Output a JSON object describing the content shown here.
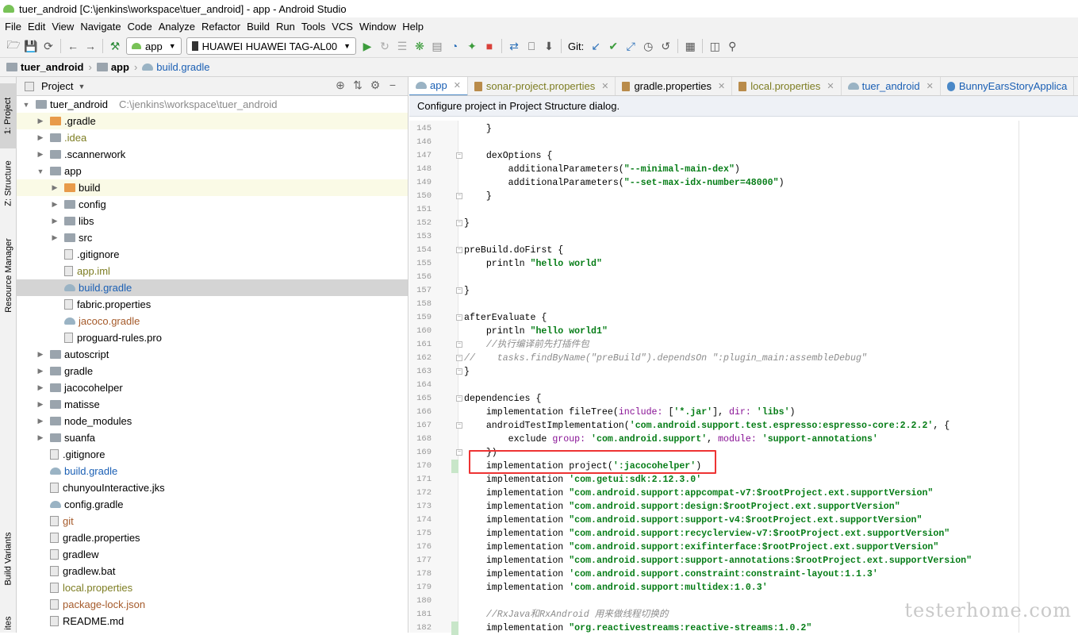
{
  "window": {
    "title": "tuer_android [C:\\jenkins\\workspace\\tuer_android] - app - Android Studio"
  },
  "menu": [
    "File",
    "Edit",
    "View",
    "Navigate",
    "Code",
    "Analyze",
    "Refactor",
    "Build",
    "Run",
    "Tools",
    "VCS",
    "Window",
    "Help"
  ],
  "toolbar": {
    "config": "app",
    "device": "HUAWEI HUAWEI TAG-AL00",
    "git_label": "Git:"
  },
  "breadcrumb": [
    "tuer_android",
    "app",
    "build.gradle"
  ],
  "project_panel": {
    "title": "Project"
  },
  "side_tabs": {
    "project": "1: Project",
    "structure": "Z: Structure",
    "resource": "Resource Manager",
    "build_variants": "Build Variants",
    "favorites": "ites"
  },
  "tree": [
    {
      "label": "tuer_android",
      "path": "C:\\jenkins\\workspace\\tuer_android",
      "depth": 0,
      "arrow": "down",
      "icon": "folder"
    },
    {
      "label": ".gradle",
      "depth": 1,
      "arrow": "right",
      "icon": "folder-orange",
      "style": "hl"
    },
    {
      "label": ".idea",
      "depth": 1,
      "arrow": "right",
      "icon": "folder",
      "color": "olive"
    },
    {
      "label": ".scannerwork",
      "depth": 1,
      "arrow": "right",
      "icon": "folder"
    },
    {
      "label": "app",
      "depth": 1,
      "arrow": "down",
      "icon": "folder"
    },
    {
      "label": "build",
      "depth": 2,
      "arrow": "right",
      "icon": "folder-orange",
      "style": "hl"
    },
    {
      "label": "config",
      "depth": 2,
      "arrow": "right",
      "icon": "folder"
    },
    {
      "label": "libs",
      "depth": 2,
      "arrow": "right",
      "icon": "folder"
    },
    {
      "label": "src",
      "depth": 2,
      "arrow": "right",
      "icon": "folder"
    },
    {
      "label": ".gitignore",
      "depth": 2,
      "icon": "file"
    },
    {
      "label": "app.iml",
      "depth": 2,
      "icon": "file",
      "color": "olive"
    },
    {
      "label": "build.gradle",
      "depth": 2,
      "icon": "gradle",
      "color": "blue",
      "style": "sel"
    },
    {
      "label": "fabric.properties",
      "depth": 2,
      "icon": "file"
    },
    {
      "label": "jacoco.gradle",
      "depth": 2,
      "icon": "gradle",
      "color": "brown"
    },
    {
      "label": "proguard-rules.pro",
      "depth": 2,
      "icon": "file"
    },
    {
      "label": "autoscript",
      "depth": 1,
      "arrow": "right",
      "icon": "folder"
    },
    {
      "label": "gradle",
      "depth": 1,
      "arrow": "right",
      "icon": "folder"
    },
    {
      "label": "jacocohelper",
      "depth": 1,
      "arrow": "right",
      "icon": "folder"
    },
    {
      "label": "matisse",
      "depth": 1,
      "arrow": "right",
      "icon": "folder"
    },
    {
      "label": "node_modules",
      "depth": 1,
      "arrow": "right",
      "icon": "folder"
    },
    {
      "label": "suanfa",
      "depth": 1,
      "arrow": "right",
      "icon": "folder"
    },
    {
      "label": ".gitignore",
      "depth": 1,
      "icon": "file"
    },
    {
      "label": "build.gradle",
      "depth": 1,
      "icon": "gradle",
      "color": "blue"
    },
    {
      "label": "chunyouInteractive.jks",
      "depth": 1,
      "icon": "file"
    },
    {
      "label": "config.gradle",
      "depth": 1,
      "icon": "gradle"
    },
    {
      "label": "git",
      "depth": 1,
      "icon": "file",
      "color": "brown"
    },
    {
      "label": "gradle.properties",
      "depth": 1,
      "icon": "file"
    },
    {
      "label": "gradlew",
      "depth": 1,
      "icon": "file"
    },
    {
      "label": "gradlew.bat",
      "depth": 1,
      "icon": "file"
    },
    {
      "label": "local.properties",
      "depth": 1,
      "icon": "file",
      "color": "olive"
    },
    {
      "label": "package-lock.json",
      "depth": 1,
      "icon": "file",
      "color": "brown"
    },
    {
      "label": "README.md",
      "depth": 1,
      "icon": "file"
    }
  ],
  "tabs": [
    {
      "label": "app",
      "color": "#1a5fb4",
      "active": true
    },
    {
      "label": "sonar-project.properties",
      "color": "#7d7d22"
    },
    {
      "label": "gradle.properties",
      "color": "#000000"
    },
    {
      "label": "local.properties",
      "color": "#7d7d22"
    },
    {
      "label": "tuer_android",
      "color": "#1a5fb4"
    },
    {
      "label": "BunnyEarsStoryApplica",
      "color": "#1a5fb4"
    }
  ],
  "banner": "Configure project in Project Structure dialog.",
  "code_lines": [
    {
      "n": "145",
      "t": "    }"
    },
    {
      "n": "146",
      "t": ""
    },
    {
      "n": "147",
      "t": "    dexOptions {"
    },
    {
      "n": "148",
      "t": "        additionalParameters(\"--minimal-main-dex\")"
    },
    {
      "n": "149",
      "t": "        additionalParameters(\"--set-max-idx-number=48000\")"
    },
    {
      "n": "150",
      "t": "    }"
    },
    {
      "n": "151",
      "t": ""
    },
    {
      "n": "152",
      "t": "}"
    },
    {
      "n": "153",
      "t": ""
    },
    {
      "n": "154",
      "t": "preBuild.doFirst {"
    },
    {
      "n": "155",
      "t": "    println \"hello world\""
    },
    {
      "n": "156",
      "t": ""
    },
    {
      "n": "157",
      "t": "}"
    },
    {
      "n": "158",
      "t": ""
    },
    {
      "n": "159",
      "t": "afterEvaluate {"
    },
    {
      "n": "160",
      "t": "    println \"hello world1\""
    },
    {
      "n": "161",
      "t": "    //执行编译前先打插件包"
    },
    {
      "n": "162",
      "t": "//    tasks.findByName(\"preBuild\").dependsOn \":plugin_main:assembleDebug\""
    },
    {
      "n": "163",
      "t": "}"
    },
    {
      "n": "164",
      "t": ""
    },
    {
      "n": "165",
      "t": "dependencies {"
    },
    {
      "n": "166",
      "t": "    implementation fileTree(include: ['*.jar'], dir: 'libs')"
    },
    {
      "n": "167",
      "t": "    androidTestImplementation('com.android.support.test.espresso:espresso-core:2.2.2', {"
    },
    {
      "n": "168",
      "t": "        exclude group: 'com.android.support', module: 'support-annotations'"
    },
    {
      "n": "169",
      "t": "    })"
    },
    {
      "n": "170",
      "t": "    implementation project(':jacocohelper')"
    },
    {
      "n": "171",
      "t": "    implementation 'com.getui:sdk:2.12.3.0'"
    },
    {
      "n": "172",
      "t": "    implementation \"com.android.support:appcompat-v7:$rootProject.ext.supportVersion\""
    },
    {
      "n": "173",
      "t": "    implementation \"com.android.support:design:$rootProject.ext.supportVersion\""
    },
    {
      "n": "174",
      "t": "    implementation \"com.android.support:support-v4:$rootProject.ext.supportVersion\""
    },
    {
      "n": "175",
      "t": "    implementation \"com.android.support:recyclerview-v7:$rootProject.ext.supportVersion\""
    },
    {
      "n": "176",
      "t": "    implementation \"com.android.support:exifinterface:$rootProject.ext.supportVersion\""
    },
    {
      "n": "177",
      "t": "    implementation \"com.android.support:support-annotations:$rootProject.ext.supportVersion\""
    },
    {
      "n": "178",
      "t": "    implementation 'com.android.support.constraint:constraint-layout:1.1.3'"
    },
    {
      "n": "179",
      "t": "    implementation 'com.android.support:multidex:1.0.3'"
    },
    {
      "n": "180",
      "t": ""
    },
    {
      "n": "181",
      "t": "    //RxJava和RxAndroid 用来做线程切换的"
    },
    {
      "n": "182",
      "t": "    implementation \"org.reactivestreams:reactive-streams:1.0.2\""
    }
  ],
  "watermark": "testerhome.com"
}
